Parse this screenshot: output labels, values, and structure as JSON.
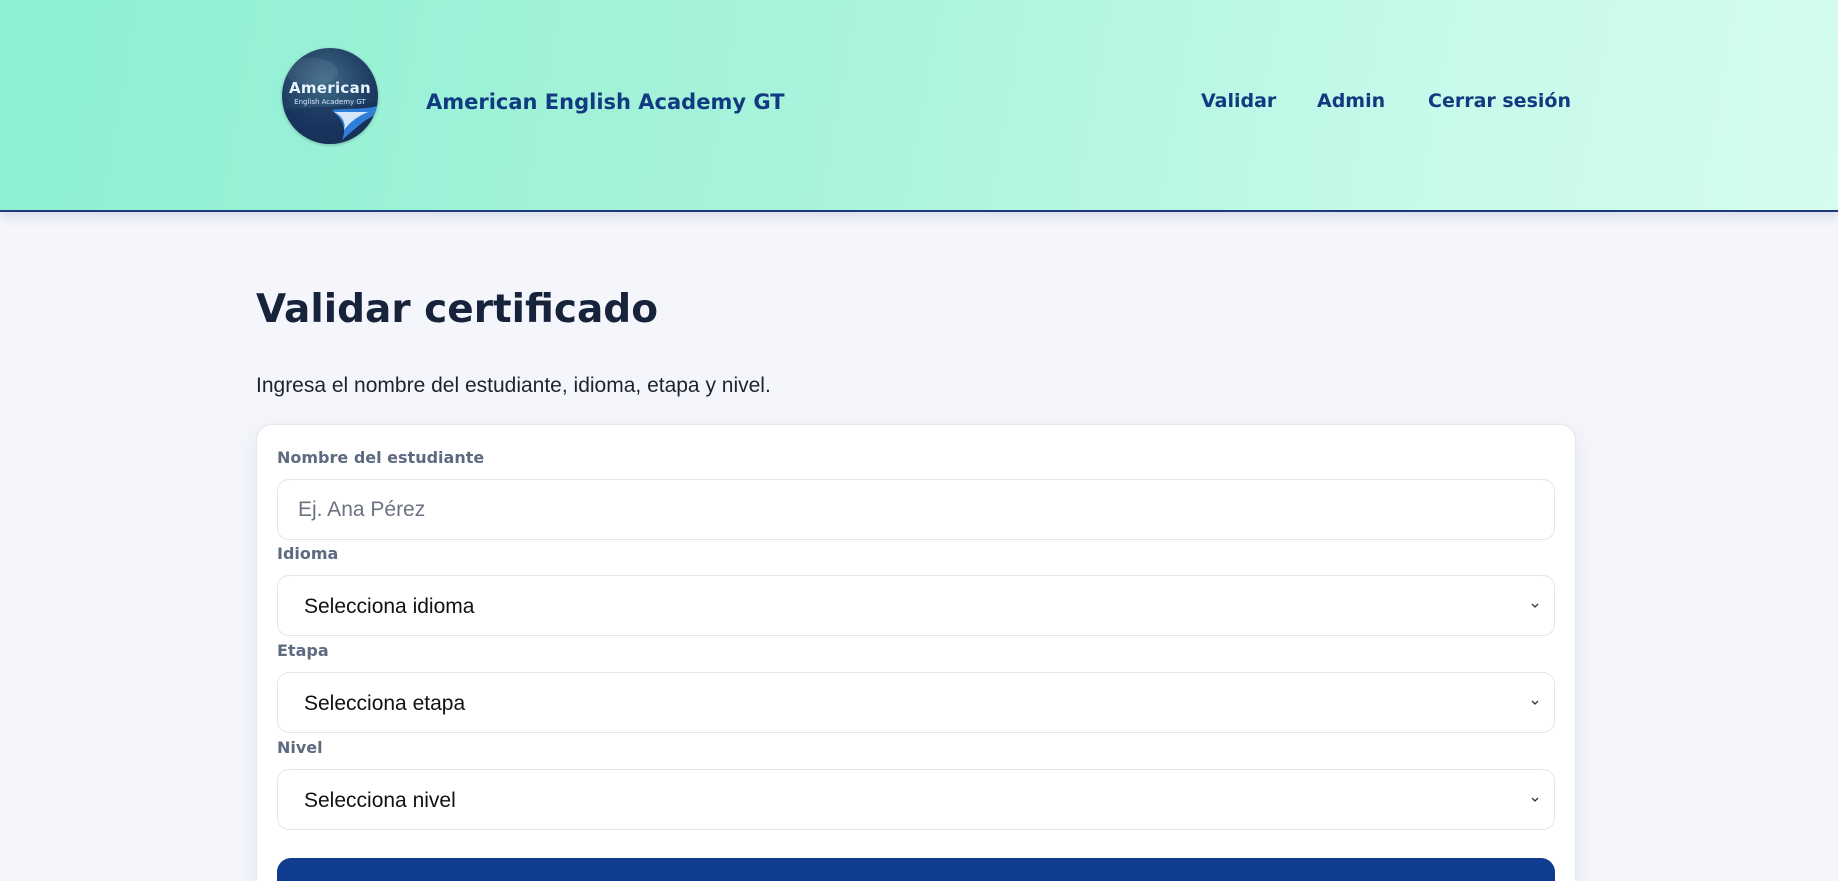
{
  "header": {
    "logo_word": "American",
    "logo_sub": "English Academy GT",
    "brand": "American English Academy GT",
    "nav": {
      "validar": "Validar",
      "admin": "Admin",
      "logout": "Cerrar sesión"
    }
  },
  "main": {
    "title": "Validar certificado",
    "subtitle": "Ingresa el nombre del estudiante, idioma, etapa y nivel."
  },
  "form": {
    "student_label": "Nombre del estudiante",
    "student_placeholder": "Ej. Ana Pérez",
    "language_label": "Idioma",
    "language_value": "Selecciona idioma",
    "stage_label": "Etapa",
    "stage_value": "Selecciona etapa",
    "level_label": "Nivel",
    "level_value": "Selecciona nivel"
  },
  "colors": {
    "header_start": "#8df0d2",
    "header_end": "#d4fcef",
    "brand_text": "#123a80",
    "button": "#0f3c8f"
  }
}
